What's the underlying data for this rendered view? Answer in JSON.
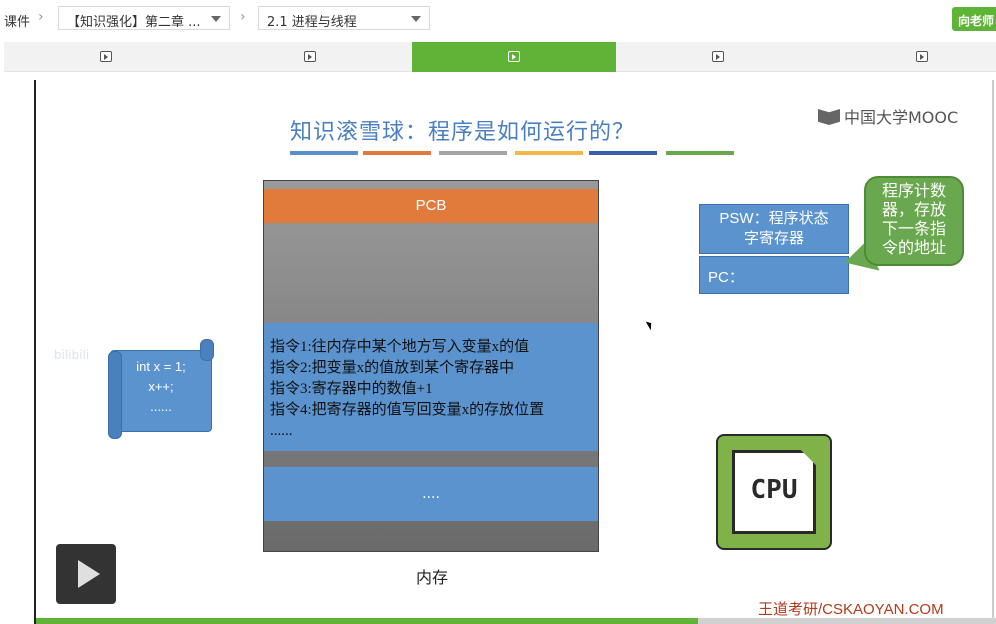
{
  "breadcrumb": {
    "courseware": "课件",
    "chapter_select": "【知识强化】第二章 ...",
    "lesson_select": "2.1 进程与线程"
  },
  "ask_teacher_label": "向老师",
  "tabs": [
    {
      "active": false,
      "icon": "play-icon"
    },
    {
      "active": false,
      "icon": "play-icon"
    },
    {
      "active": true,
      "icon": "play-icon"
    },
    {
      "active": false,
      "icon": "play-icon"
    },
    {
      "active": false,
      "icon": "play-icon"
    }
  ],
  "slide": {
    "title": "知识滚雪球：程序是如何运行的？",
    "title_bar_colors": [
      "#5b8fc9",
      "#e07b3c",
      "#a5a5a5",
      "#f0b94a",
      "#3c5ea9",
      "#6aa84f"
    ],
    "logo": "中国大学MOOC",
    "pcb": "PCB",
    "instructions": [
      "指令1:往内存中某个地方写入变量x的值",
      "指令2:把变量x的值放到某个寄存器中",
      "指令3:寄存器中的数值+1",
      "指令4:把寄存器的值写回变量x的存放位置",
      "......"
    ],
    "memory_block_text": "....",
    "memory_label": "内存",
    "code_lines": [
      "int x = 1;",
      "x++;",
      "......"
    ],
    "watermark": "bilibili",
    "psw_label": "PSW：程序状态字寄存器",
    "pc_label": "PC：",
    "callout_text": "程序计数器，存放下一条指令的地址",
    "cpu_label": "CPU",
    "brand": "王道考研/CSKAOYAN.COM"
  },
  "player": {
    "progress_fraction": 0.69
  },
  "colors": {
    "accent_green": "#5fb336",
    "box_blue": "#5b93cf",
    "pcb_orange": "#e07b3c"
  }
}
